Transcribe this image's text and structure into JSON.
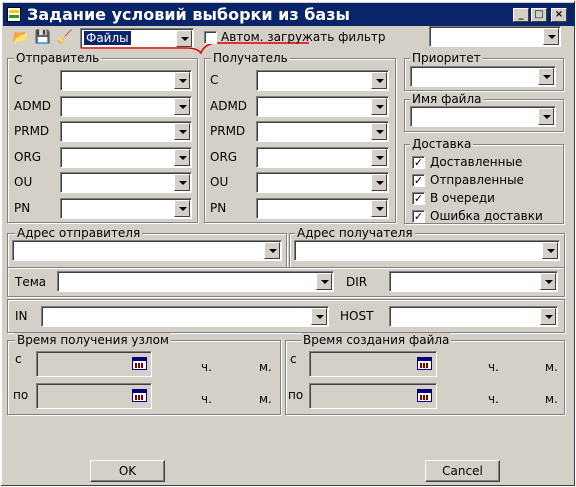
{
  "window": {
    "title": "Задание условий выборки из базы"
  },
  "toolbar": {
    "filter_combo_value": "Файлы",
    "auto_filter_label": "Автом. загружать фильтр",
    "auto_filter_checked": false
  },
  "sender": {
    "title": "Отправитель",
    "fields": [
      "C",
      "ADMD",
      "PRMD",
      "ORG",
      "OU",
      "PN"
    ]
  },
  "recipient": {
    "title": "Получатель",
    "fields": [
      "C",
      "ADMD",
      "PRMD",
      "ORG",
      "OU",
      "PN"
    ]
  },
  "priority": {
    "title": "Приоритет"
  },
  "filename": {
    "title": "Имя файла"
  },
  "delivery": {
    "title": "Доставка",
    "items": [
      {
        "label": "Доставленные",
        "checked": true
      },
      {
        "label": "Отправленные",
        "checked": true
      },
      {
        "label": "В очереди",
        "checked": true
      },
      {
        "label": "Ошибка доставки",
        "checked": true
      }
    ]
  },
  "sender_address": {
    "title": "Адрес отправителя"
  },
  "recipient_address": {
    "title": "Адрес получателя"
  },
  "subject": {
    "label": "Тема"
  },
  "dir": {
    "label": "DIR"
  },
  "in": {
    "label": "IN"
  },
  "host": {
    "label": "HOST"
  },
  "node_time": {
    "title": "Время получения узлом",
    "from": "с",
    "to": "по",
    "hours": "ч.",
    "minutes": "м."
  },
  "file_time": {
    "title": "Время создания файла",
    "from": "с",
    "to": "по",
    "hours": "ч.",
    "minutes": "м."
  },
  "buttons": {
    "ok": "OK",
    "cancel": "Cancel"
  },
  "icons": [
    "app-icon",
    "open-filter-icon",
    "save-filter-icon",
    "clear-filter-icon",
    "calendar-icon"
  ]
}
